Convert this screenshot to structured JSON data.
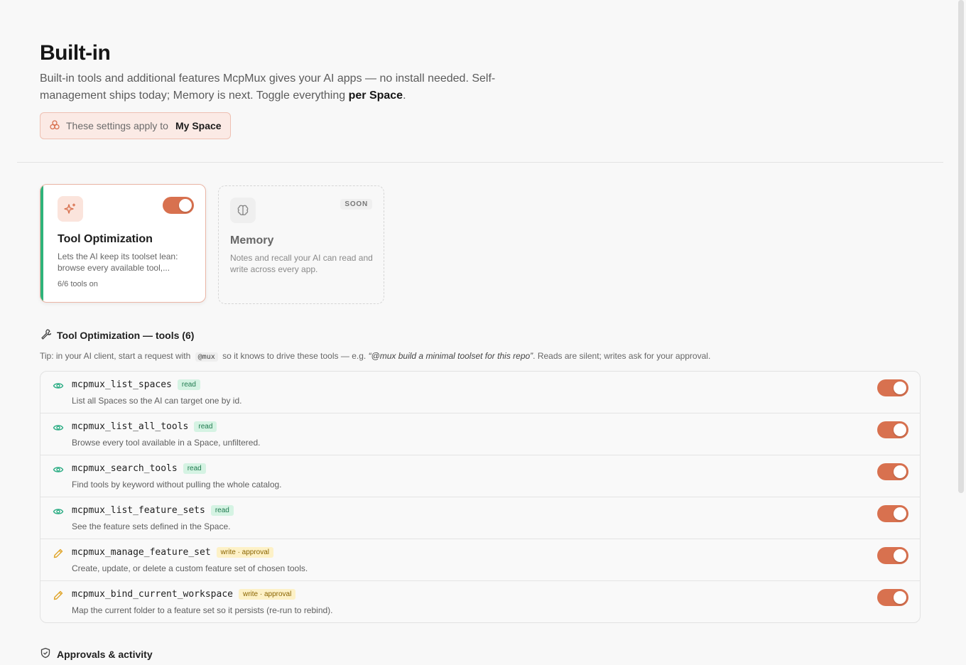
{
  "header": {
    "title": "Built-in",
    "subtitle_pre": "Built-in tools and additional features McpMux gives your AI apps — no install needed. Self-management ships today; Memory is next. Toggle everything ",
    "subtitle_bold": "per Space",
    "subtitle_post": "."
  },
  "scope": {
    "prefix": "These settings apply to",
    "space": "My Space"
  },
  "features": [
    {
      "title": "Tool Optimization",
      "description": "Lets the AI keep its toolset lean: browse every available tool,...",
      "count": "6/6 tools on",
      "enabled": true,
      "icon": "sparkles-icon"
    },
    {
      "title": "Memory",
      "description": "Notes and recall your AI can read and write across every app.",
      "badge": "SOON",
      "icon": "brain-icon"
    }
  ],
  "tools_section": {
    "title": "Tool Optimization — tools (6)",
    "tip_pre": "Tip: in your AI client, start a request with",
    "tip_code": "@mux",
    "tip_mid": "so it knows to drive these tools — e.g.",
    "tip_example": "“@mux build a minimal toolset for this repo”",
    "tip_post": ". Reads are silent; writes ask for your approval."
  },
  "tools": [
    {
      "name": "mcpmux_list_spaces",
      "badge": "read",
      "kind": "read",
      "description": "List all Spaces so the AI can target one by id.",
      "enabled": true
    },
    {
      "name": "mcpmux_list_all_tools",
      "badge": "read",
      "kind": "read",
      "description": "Browse every tool available in a Space, unfiltered.",
      "enabled": true
    },
    {
      "name": "mcpmux_search_tools",
      "badge": "read",
      "kind": "read",
      "description": "Find tools by keyword without pulling the whole catalog.",
      "enabled": true
    },
    {
      "name": "mcpmux_list_feature_sets",
      "badge": "read",
      "kind": "read",
      "description": "See the feature sets defined in the Space.",
      "enabled": true
    },
    {
      "name": "mcpmux_manage_feature_set",
      "badge": "write · approval",
      "kind": "write",
      "description": "Create, update, or delete a custom feature set of chosen tools.",
      "enabled": true
    },
    {
      "name": "mcpmux_bind_current_workspace",
      "badge": "write · approval",
      "kind": "write",
      "description": "Map the current folder to a feature set so it persists (re-run to rebind).",
      "enabled": true
    }
  ],
  "approvals_section": {
    "title": "Approvals & activity"
  },
  "colors": {
    "accent": "#d8714f",
    "active_bar": "#2fb37a",
    "read_icon": "#2fae86",
    "write_icon": "#e0a52a"
  }
}
